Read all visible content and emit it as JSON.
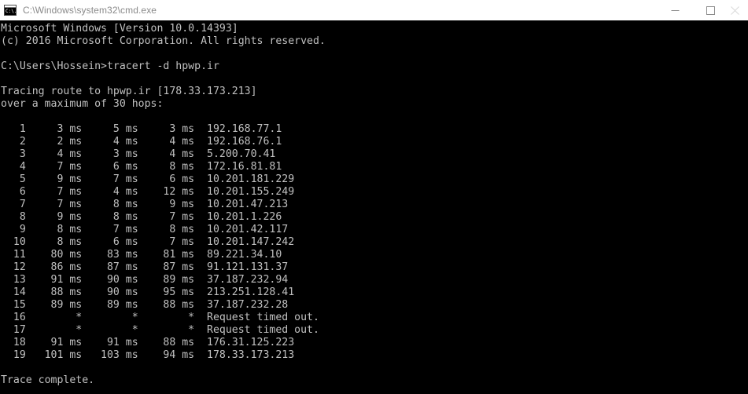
{
  "window": {
    "title": "C:\\Windows\\system32\\cmd.exe",
    "icon": "cmd-console-icon",
    "icon_glyph": "C:\\.",
    "titlebar_bg": "#ffffff",
    "titlebar_text_color": "#8a8a8a",
    "console_bg": "#000000",
    "console_text_color": "#c0c0c0"
  },
  "controls": {
    "minimize_label": "Minimize",
    "maximize_label": "Maximize",
    "close_label": "Close"
  },
  "console": {
    "banner": [
      "Microsoft Windows [Version 10.0.14393]",
      "(c) 2016 Microsoft Corporation. All rights reserved."
    ],
    "prompt": "C:\\Users\\Hossein>",
    "command": "tracert -d hpwp.ir",
    "prompt_line": "C:\\Users\\Hossein>tracert -d hpwp.ir",
    "trace_header": [
      "Tracing route to hpwp.ir [178.33.173.213]",
      "over a maximum of 30 hops:"
    ],
    "target_host": "hpwp.ir",
    "target_ip": "178.33.173.213",
    "max_hops": "30",
    "hops": [
      {
        "hop": "1",
        "rtt1": "3 ms",
        "rtt2": "5 ms",
        "rtt3": "3 ms",
        "host": "192.168.77.1"
      },
      {
        "hop": "2",
        "rtt1": "2 ms",
        "rtt2": "4 ms",
        "rtt3": "4 ms",
        "host": "192.168.76.1"
      },
      {
        "hop": "3",
        "rtt1": "4 ms",
        "rtt2": "3 ms",
        "rtt3": "4 ms",
        "host": "5.200.70.41"
      },
      {
        "hop": "4",
        "rtt1": "7 ms",
        "rtt2": "6 ms",
        "rtt3": "8 ms",
        "host": "172.16.81.81"
      },
      {
        "hop": "5",
        "rtt1": "9 ms",
        "rtt2": "7 ms",
        "rtt3": "6 ms",
        "host": "10.201.181.229"
      },
      {
        "hop": "6",
        "rtt1": "7 ms",
        "rtt2": "4 ms",
        "rtt3": "12 ms",
        "host": "10.201.155.249"
      },
      {
        "hop": "7",
        "rtt1": "7 ms",
        "rtt2": "8 ms",
        "rtt3": "9 ms",
        "host": "10.201.47.213"
      },
      {
        "hop": "8",
        "rtt1": "9 ms",
        "rtt2": "8 ms",
        "rtt3": "7 ms",
        "host": "10.201.1.226"
      },
      {
        "hop": "9",
        "rtt1": "8 ms",
        "rtt2": "7 ms",
        "rtt3": "8 ms",
        "host": "10.201.42.117"
      },
      {
        "hop": "10",
        "rtt1": "8 ms",
        "rtt2": "6 ms",
        "rtt3": "7 ms",
        "host": "10.201.147.242"
      },
      {
        "hop": "11",
        "rtt1": "80 ms",
        "rtt2": "83 ms",
        "rtt3": "81 ms",
        "host": "89.221.34.10"
      },
      {
        "hop": "12",
        "rtt1": "86 ms",
        "rtt2": "87 ms",
        "rtt3": "87 ms",
        "host": "91.121.131.37"
      },
      {
        "hop": "13",
        "rtt1": "91 ms",
        "rtt2": "90 ms",
        "rtt3": "89 ms",
        "host": "37.187.232.94"
      },
      {
        "hop": "14",
        "rtt1": "88 ms",
        "rtt2": "90 ms",
        "rtt3": "95 ms",
        "host": "213.251.128.41"
      },
      {
        "hop": "15",
        "rtt1": "89 ms",
        "rtt2": "89 ms",
        "rtt3": "88 ms",
        "host": "37.187.232.28"
      },
      {
        "hop": "16",
        "rtt1": "*",
        "rtt2": "*",
        "rtt3": "*",
        "host": "Request timed out."
      },
      {
        "hop": "17",
        "rtt1": "*",
        "rtt2": "*",
        "rtt3": "*",
        "host": "Request timed out."
      },
      {
        "hop": "18",
        "rtt1": "91 ms",
        "rtt2": "91 ms",
        "rtt3": "88 ms",
        "host": "176.31.125.223"
      },
      {
        "hop": "19",
        "rtt1": "101 ms",
        "rtt2": "103 ms",
        "rtt3": "94 ms",
        "host": "178.33.173.213"
      }
    ],
    "footer": "Trace complete."
  }
}
